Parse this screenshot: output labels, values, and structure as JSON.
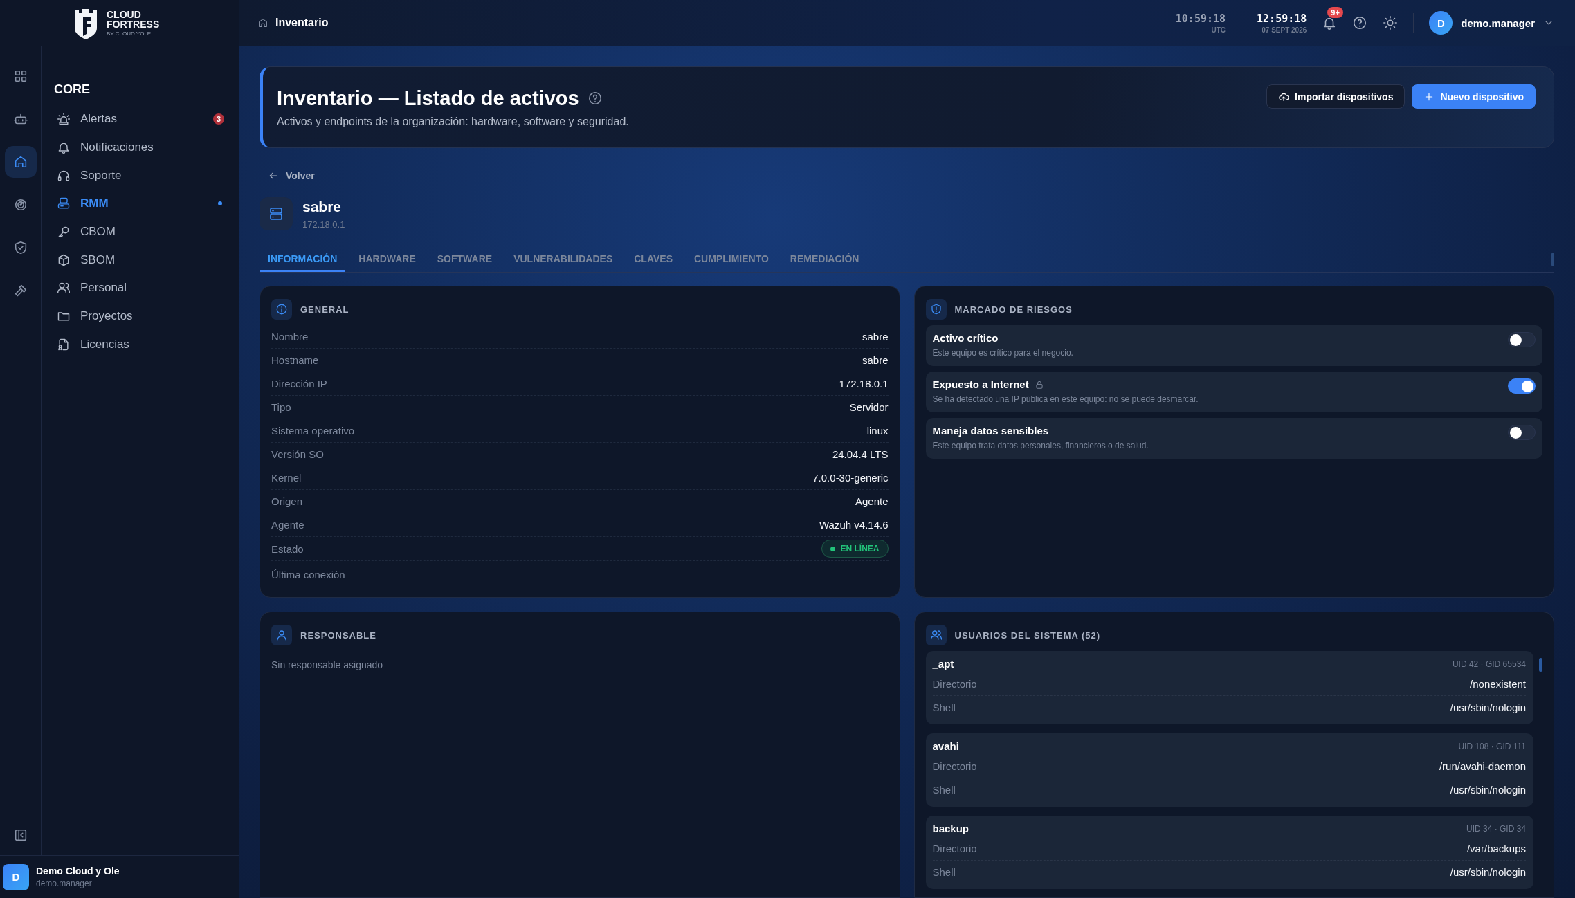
{
  "brand": {
    "name_lines": [
      "CLOUD",
      "FORTRESS"
    ],
    "tagline": "BY CLOUD YOLE"
  },
  "rail": {
    "items": [
      {
        "selected": false
      },
      {
        "selected": false
      },
      {
        "selected": true
      },
      {
        "selected": false
      },
      {
        "selected": false
      },
      {
        "selected": false
      }
    ]
  },
  "breadcrumb": "Inventario",
  "clock": {
    "utc_time": "10:59:18",
    "utc_label": "UTC",
    "local_time": "12:59:18",
    "local_date": "07 SEPT 2026"
  },
  "notifications": {
    "badge": "9+"
  },
  "user": {
    "avatar": "D",
    "name": "demo.manager"
  },
  "sidebar": {
    "section": "CORE",
    "items": [
      {
        "label": "Alertas",
        "selected": false,
        "badge": "3"
      },
      {
        "label": "Notificaciones",
        "selected": false
      },
      {
        "label": "Soporte",
        "selected": false
      },
      {
        "label": "RMM",
        "selected": true
      },
      {
        "label": "CBOM",
        "selected": false
      },
      {
        "label": "SBOM",
        "selected": false
      },
      {
        "label": "Personal",
        "selected": false
      },
      {
        "label": "Proyectos",
        "selected": false
      },
      {
        "label": "Licencias",
        "selected": false
      }
    ]
  },
  "org": {
    "avatar": "D",
    "name": "Demo Cloud y Ole",
    "user": "demo.manager"
  },
  "page_header": {
    "title": "Inventario — Listado de activos",
    "subtitle": "Activos y endpoints de la organización: hardware, software y seguridad.",
    "buttons": [
      {
        "label": "Importar dispositivos",
        "kind": "secondary"
      },
      {
        "label": "Nuevo dispositivo",
        "kind": "primary"
      }
    ]
  },
  "back_link": "Volver",
  "device": {
    "name": "sabre",
    "ip": "172.18.0.1"
  },
  "tabs": [
    {
      "label": "INFORMACIÓN",
      "selected": true
    },
    {
      "label": "HARDWARE",
      "selected": false
    },
    {
      "label": "SOFTWARE",
      "selected": false
    },
    {
      "label": "VULNERABILIDADES",
      "selected": false
    },
    {
      "label": "CLAVES",
      "selected": false
    },
    {
      "label": "CUMPLIMIENTO",
      "selected": false
    },
    {
      "label": "REMEDIACIÓN",
      "selected": false
    }
  ],
  "general": {
    "title": "GENERAL",
    "rows": [
      {
        "label": "Nombre",
        "value": "sabre",
        "kind": "text"
      },
      {
        "label": "Hostname",
        "value": "sabre",
        "kind": "text"
      },
      {
        "label": "Dirección IP",
        "value": "172.18.0.1",
        "kind": "text"
      },
      {
        "label": "Tipo",
        "value": "Servidor",
        "kind": "text"
      },
      {
        "label": "Sistema operativo",
        "value": "linux",
        "kind": "text"
      },
      {
        "label": "Versión SO",
        "value": "24.04.4 LTS",
        "kind": "text"
      },
      {
        "label": "Kernel",
        "value": "7.0.0-30-generic",
        "kind": "text"
      },
      {
        "label": "Origen",
        "value": "Agente",
        "kind": "text"
      },
      {
        "label": "Agente",
        "value": "Wazuh v4.14.6",
        "kind": "text"
      },
      {
        "label": "Estado",
        "value": "EN LÍNEA",
        "kind": "status"
      },
      {
        "label": "Última conexión",
        "value": "—",
        "kind": "text"
      }
    ]
  },
  "risk": {
    "title": "MARCADO DE RIESGOS",
    "flags": [
      {
        "title": "Activo crítico",
        "description": "Este equipo es crítico para el negocio.",
        "on": false,
        "locked": false
      },
      {
        "title": "Expuesto a Internet",
        "description": "Se ha detectado una IP pública en este equipo: no se puede desmarcar.",
        "on": true,
        "locked": true
      },
      {
        "title": "Maneja datos sensibles",
        "description": "Este equipo trata datos personales, financieros o de salud.",
        "on": false,
        "locked": false
      }
    ]
  },
  "owner": {
    "title": "RESPONSABLE",
    "empty_text": "Sin responsable asignado"
  },
  "system_users": {
    "title": "USUARIOS DEL SISTEMA (52)",
    "users": [
      {
        "name": "_apt",
        "ids": "UID 42 · GID 65534",
        "fields": [
          {
            "label": "Directorio",
            "value": "/nonexistent"
          },
          {
            "label": "Shell",
            "value": "/usr/sbin/nologin"
          }
        ]
      },
      {
        "name": "avahi",
        "ids": "UID 108 · GID 111",
        "fields": [
          {
            "label": "Directorio",
            "value": "/run/avahi-daemon"
          },
          {
            "label": "Shell",
            "value": "/usr/sbin/nologin"
          }
        ]
      },
      {
        "name": "backup",
        "ids": "UID 34 · GID 34",
        "fields": [
          {
            "label": "Directorio",
            "value": "/var/backups"
          },
          {
            "label": "Shell",
            "value": "/usr/sbin/nologin"
          }
        ]
      }
    ]
  }
}
